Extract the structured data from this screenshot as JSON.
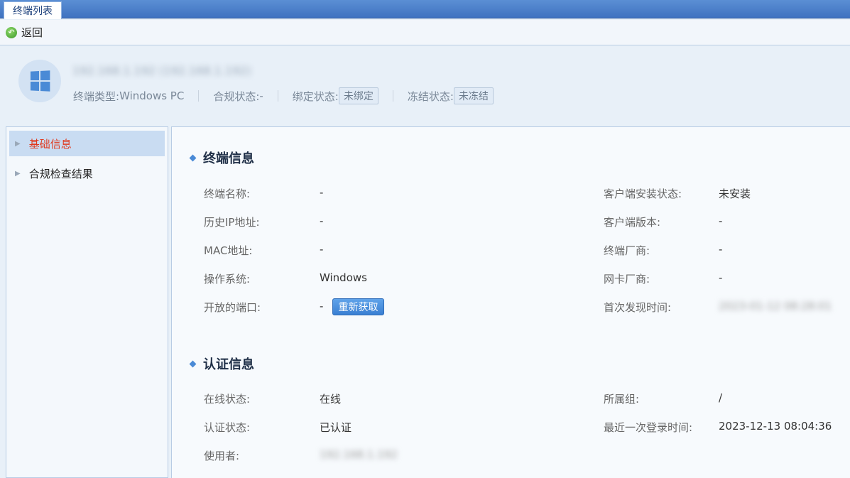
{
  "tabbar": {
    "tab_label": "终端列表"
  },
  "toolbar": {
    "back_label": "返回"
  },
  "header": {
    "host_name": "192.168.1.192 (192.168.1.192)",
    "type_label": "终端类型:",
    "type_value": "Windows PC",
    "compliance_label": "合规状态:",
    "compliance_value": "-",
    "binding_label": "绑定状态:",
    "binding_value": "未绑定",
    "freeze_label": "冻结状态:",
    "freeze_value": "未冻结"
  },
  "nav": {
    "items": [
      {
        "label": "基础信息",
        "active": true
      },
      {
        "label": "合规检查结果",
        "active": false
      }
    ]
  },
  "terminal_info": {
    "title": "终端信息",
    "name_label": "终端名称:",
    "name_value": "-",
    "history_ip_label": "历史IP地址:",
    "history_ip_value": "-",
    "mac_label": "MAC地址:",
    "mac_value": "-",
    "os_label": "操作系统:",
    "os_value": "Windows",
    "ports_label": "开放的端口:",
    "ports_value": "-",
    "refresh_label": "重新获取",
    "client_status_label": "客户端安装状态:",
    "client_status_value": "未安装",
    "client_version_label": "客户端版本:",
    "client_version_value": "-",
    "vendor_label": "终端厂商:",
    "vendor_value": "-",
    "nic_vendor_label": "网卡厂商:",
    "nic_vendor_value": "-",
    "first_seen_label": "首次发现时间:",
    "first_seen_value": "2023-01-12 08:28:01"
  },
  "auth_info": {
    "title": "认证信息",
    "online_label": "在线状态:",
    "online_value": "在线",
    "auth_label": "认证状态:",
    "auth_value": "已认证",
    "user_label": "使用者:",
    "user_value": "192.168.1.192",
    "group_label": "所属组:",
    "group_value": "/",
    "last_login_label": "最近一次登录时间:",
    "last_login_value": "2023-12-13 08:04:36"
  }
}
